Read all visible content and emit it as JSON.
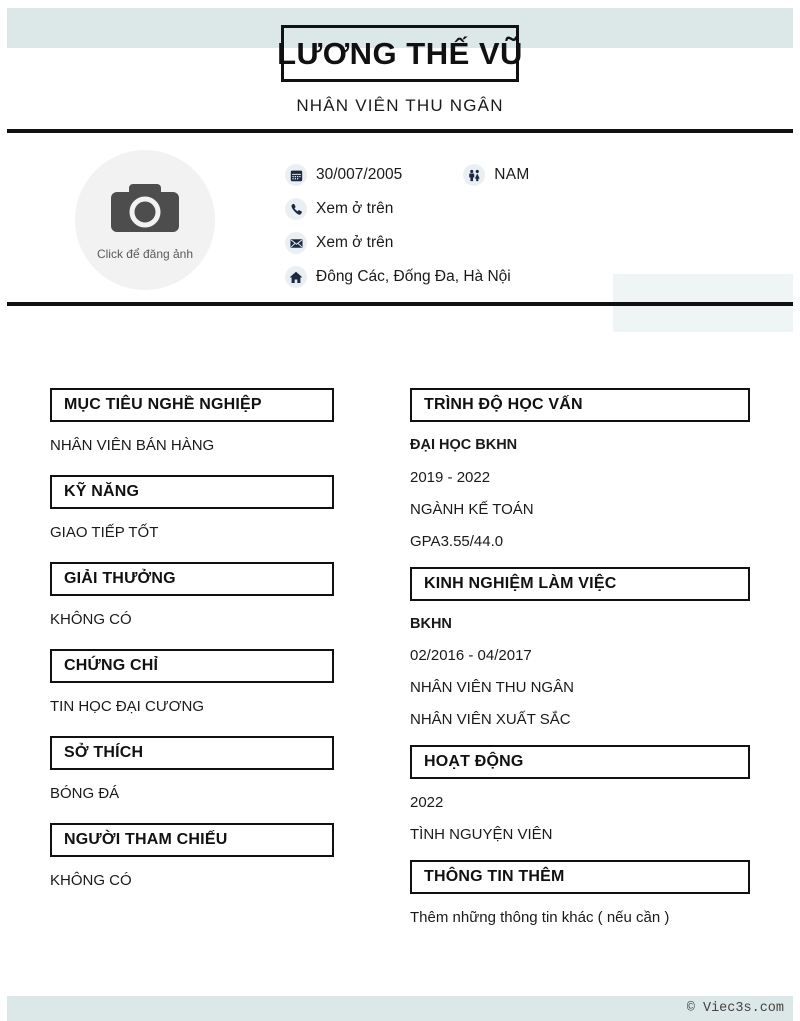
{
  "document": {
    "type": "cv-resume",
    "language": "vi"
  },
  "theme": {
    "band_color": "#dce8e8",
    "panel_color": "#eff5f5",
    "rule_color": "#111111",
    "icon_color": "#1b2a41",
    "icon_bg": "#eaeff3",
    "photo_bg": "#f2f2f2",
    "text_color": "#1a1a1a"
  },
  "header": {
    "name": "LƯƠNG THẾ VŨ",
    "job_title": "NHÂN VIÊN THU NGÂN"
  },
  "photo": {
    "icon": "camera-icon",
    "caption": "Click để đăng ảnh"
  },
  "contact": {
    "birthday": {
      "icon": "calendar-icon",
      "value": "30/007/2005"
    },
    "gender": {
      "icon": "gender-icon",
      "value": "NAM"
    },
    "phone": {
      "icon": "phone-icon",
      "value": "Xem ở trên"
    },
    "email": {
      "icon": "mail-icon",
      "value": "Xem ở trên"
    },
    "address": {
      "icon": "home-icon",
      "value": "Đông Các, Đống Đa, Hà Nội"
    }
  },
  "left_column": {
    "sections": [
      {
        "title": "MỤC TIÊU NGHỀ NGHIỆP",
        "lines": [
          "NHÂN VIÊN BÁN HÀNG"
        ]
      },
      {
        "title": "KỸ NĂNG",
        "lines": [
          "GIAO TIẾP TỐT"
        ]
      },
      {
        "title": "GIẢI THƯỞNG",
        "lines": [
          "KHÔNG CÓ"
        ]
      },
      {
        "title": "CHỨNG CHỈ",
        "lines": [
          "TIN HỌC ĐẠI CƯƠNG"
        ]
      },
      {
        "title": "SỞ THÍCH",
        "lines": [
          "BÓNG ĐÁ"
        ]
      },
      {
        "title": "NGƯỜI THAM CHIẾU",
        "lines": [
          "KHÔNG CÓ"
        ]
      }
    ]
  },
  "right_column": {
    "sections": [
      {
        "title": "TRÌNH ĐỘ HỌC VẤN",
        "lines": [
          {
            "text": "ĐẠI HỌC BKHN",
            "bold": true
          },
          {
            "text": "2019 - 2022",
            "bold": false
          },
          {
            "text": "NGÀNH KẾ TOÁN",
            "bold": false
          },
          {
            "text": "GPA3.55/44.0",
            "bold": false
          }
        ]
      },
      {
        "title": "KINH NGHIỆM LÀM VIỆC",
        "lines": [
          {
            "text": "BKHN",
            "bold": true
          },
          {
            "text": "02/2016 - 04/2017",
            "bold": false
          },
          {
            "text": "NHÂN VIÊN THU NGÂN",
            "bold": false
          },
          {
            "text": "NHÂN VIÊN XUẤT SẮC",
            "bold": false
          }
        ]
      },
      {
        "title": "HOẠT ĐỘNG",
        "lines": [
          {
            "text": "2022",
            "bold": false
          },
          {
            "text": "TÌNH NGUYỆN VIÊN",
            "bold": false
          }
        ]
      },
      {
        "title": "THÔNG TIN THÊM",
        "lines": [
          {
            "text": "Thêm những thông tin khác ( nếu cần )",
            "bold": false
          }
        ]
      }
    ]
  },
  "footer": {
    "copyright": "© Viec3s.com"
  }
}
